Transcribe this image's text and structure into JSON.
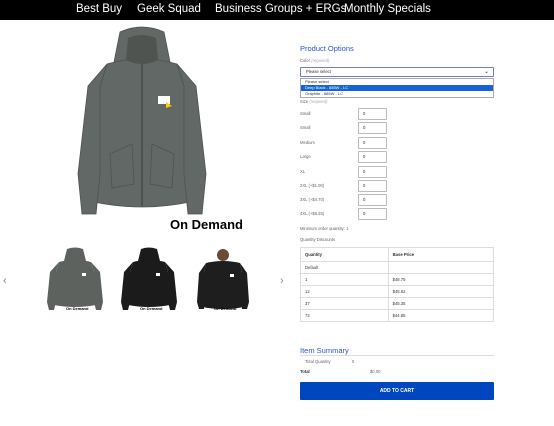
{
  "nav": {
    "items": [
      "Best Buy",
      "Geek Squad",
      "Business Groups + ERGs",
      "Monthly Specials"
    ]
  },
  "product": {
    "caption": "On Demand",
    "thumbnails": [
      {
        "label": "On Demand",
        "color": "#5d625e"
      },
      {
        "label": "On Demand",
        "color": "#1b1b1b"
      },
      {
        "label": "On Demand",
        "color": "#1e1e1e"
      }
    ],
    "main_color": "#626865",
    "logo_colors": [
      "#ffffff",
      "#f6d100"
    ]
  },
  "options": {
    "title": "Product Options",
    "color_label": "Color",
    "required": "(required)",
    "color_placeholder": "Please select",
    "color_options": [
      "Please select",
      "Deep Black - 885W - LC",
      "Graphite - 885W - LC"
    ],
    "size_label": "Size",
    "sizes": [
      {
        "label": "Small",
        "qty": "0"
      },
      {
        "label": "Small",
        "qty": "0"
      },
      {
        "label": "Medium",
        "qty": "0"
      },
      {
        "label": "Large",
        "qty": "0"
      },
      {
        "label": "XL",
        "qty": "0"
      },
      {
        "label": "2XL (+$1.00)",
        "qty": "0"
      },
      {
        "label": "3XL (+$4.70)",
        "qty": "0"
      },
      {
        "label": "4XL (+$6.25)",
        "qty": "0"
      }
    ],
    "min_qty": "Minimum order quantity: 1",
    "qty_discounts": "Quantity Discounts"
  },
  "discounts": {
    "headers": [
      "Quantity",
      "Base Price"
    ],
    "rows": [
      [
        "Default",
        ""
      ],
      [
        "1",
        "$48.75"
      ],
      [
        "12",
        "$45.62"
      ],
      [
        "37",
        "$45.35"
      ],
      [
        "72",
        "$44.85"
      ]
    ]
  },
  "summary": {
    "title": "Item Summary",
    "total_qty_label": "Total Quantity",
    "total_qty": "0",
    "total_label": "Total",
    "total_value": "$0.00"
  },
  "cart_button": "ADD TO CART",
  "accent": "#0046be",
  "link_color": "#2b55c8"
}
